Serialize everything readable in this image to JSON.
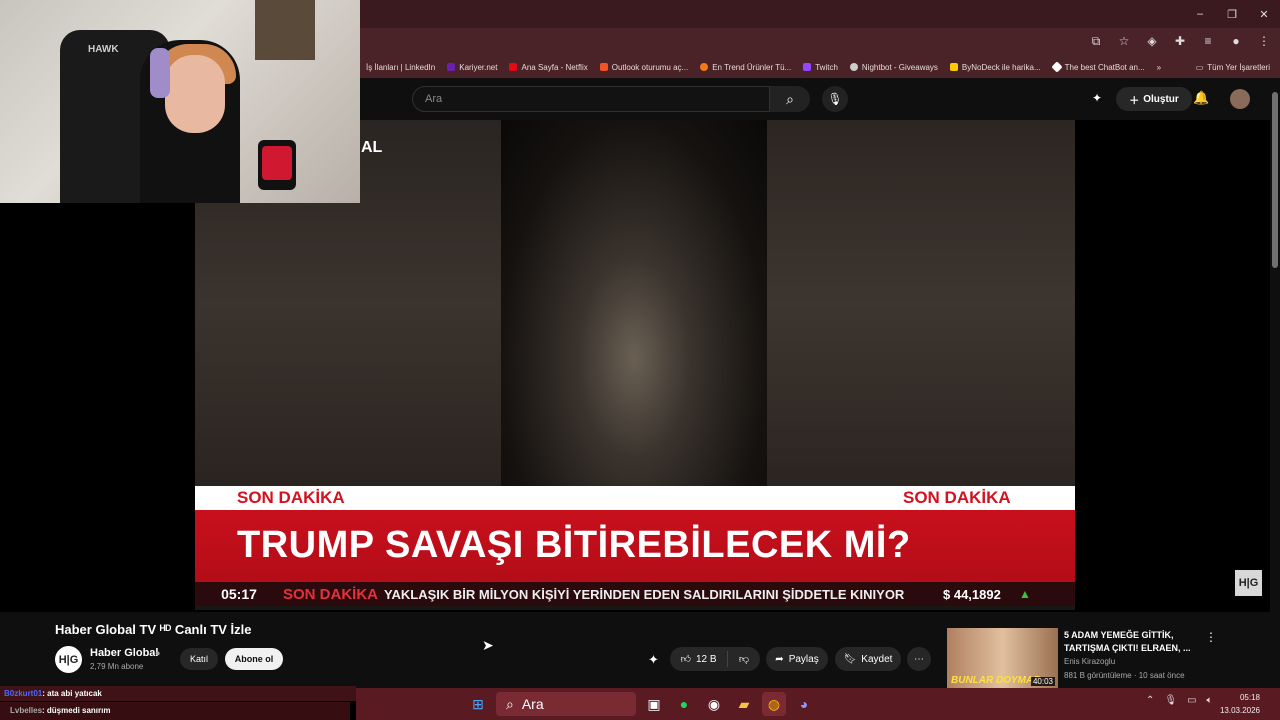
{
  "window": {
    "controls": [
      "–",
      "❐",
      "✕"
    ]
  },
  "bookmarks": [
    {
      "label": "İş İlanları | LinkedIn",
      "color": "#0a66c2"
    },
    {
      "label": "Kariyer.net",
      "color": "#6a1fb0"
    },
    {
      "label": "Ana Sayfa - Netflix",
      "color": "#e50914"
    },
    {
      "label": "Outlook oturumu aç...",
      "color": "#f35325"
    },
    {
      "label": "En Trend Ürünler Tü...",
      "color": "#f27a1a"
    },
    {
      "label": "Twitch",
      "color": "#9146ff"
    },
    {
      "label": "Nightbot - Giveaways",
      "color": "#cccccc"
    },
    {
      "label": "ByNoDeck ile harika...",
      "color": "#ffcc00"
    },
    {
      "label": "The best ChatBot an...",
      "color": "#ffffff"
    }
  ],
  "bookmarks_overflow": "»",
  "bookmarks_all": "Tüm Yer İşaretleri",
  "youtube": {
    "search_placeholder": "Ara",
    "create_label": "Oluştur"
  },
  "overlay_text": "AL",
  "video": {
    "breaking_label": "SON DAKİKA",
    "headline": "TRUMP SAVAŞI BİTİREBİLECEK Mİ?",
    "ticker_time": "05:17",
    "ticker_label": "SON DAKİKA",
    "ticker_news": "YAKLAŞIK BİR MİLYON KİŞİYİ YERİNDEN EDEN SALDIRILARINI ŞİDDETLE KINIYOR",
    "currency": "$  44,1892",
    "watermark": "H|G"
  },
  "webcam": {
    "chair_logo": "HAWK"
  },
  "info": {
    "title": "Haber Global TV ᴴᴰ Canlı TV İzle",
    "channel_logo": "H|G",
    "channel_name": "Haber Global",
    "verified": "●",
    "subscribers": "2,79 Mn abone",
    "join_label": "Katıl",
    "subscribe_label": "Abone ol",
    "like_count": "12 B",
    "share_label": "Paylaş",
    "save_label": "Kaydet"
  },
  "recommendation": {
    "title": "5 ADAM YEMEĞE GİTTİK, TARTIŞMA ÇIKTI! ELRAEN, ...",
    "channel": "Enis Kirazoglu",
    "meta": "881 B görüntüleme · 10 saat önce",
    "thumb_caption": "BUNLAR DOYMAZ",
    "duration": "40:03"
  },
  "chat": [
    {
      "user": "B0zkurt01",
      "message": ": ata abi yatıcak"
    },
    {
      "user": "Lvbelles",
      "message": ": düşmedi sanırım"
    }
  ],
  "taskbar": {
    "search_label": "Ara",
    "time": "05:18",
    "date": "13.03.2026"
  }
}
